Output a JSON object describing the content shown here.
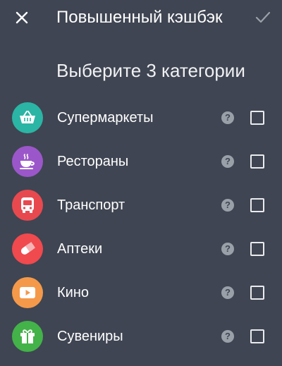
{
  "header": {
    "title": "Повышенный кэшбэк",
    "close_icon": "close-icon",
    "confirm_icon": "checkmark-icon"
  },
  "subtitle": "Выберите 3 категории",
  "help_glyph": "?",
  "categories": [
    {
      "label": "Супермаркеты",
      "icon": "shopping-basket-icon",
      "color": "#2bb5a4",
      "checked": false
    },
    {
      "label": "Рестораны",
      "icon": "coffee-cup-icon",
      "color": "#9b57c9",
      "checked": false
    },
    {
      "label": "Транспорт",
      "icon": "bus-icon",
      "color": "#e8494f",
      "checked": false
    },
    {
      "label": "Аптеки",
      "icon": "pill-icon",
      "color": "#f0494e",
      "checked": false
    },
    {
      "label": "Кино",
      "icon": "play-video-icon",
      "color": "#f4994a",
      "checked": false
    },
    {
      "label": "Сувениры",
      "icon": "gift-icon",
      "color": "#43b249",
      "checked": false
    }
  ]
}
